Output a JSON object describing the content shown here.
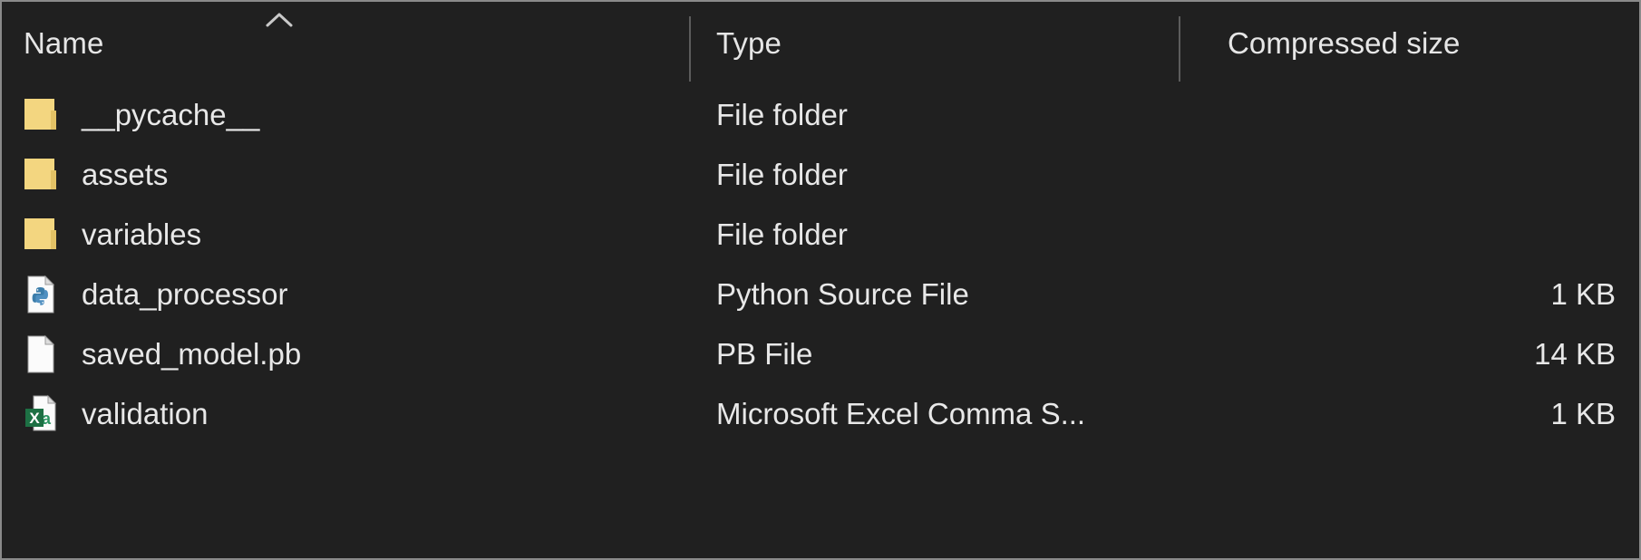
{
  "window": {
    "background_color": "#202020",
    "border_color": "#8a8a8a",
    "text_color": "#e8e8e8"
  },
  "columns": {
    "name": {
      "label": "Name",
      "sort_icon": "chevron-up-icon",
      "sort_direction": "ascending"
    },
    "type": {
      "label": "Type"
    },
    "size": {
      "label": "Compressed size"
    }
  },
  "files": [
    {
      "name": "__pycache__",
      "type": "File folder",
      "size": "",
      "icon": "folder-icon",
      "icon_color": "#f3d680"
    },
    {
      "name": "assets",
      "type": "File folder",
      "size": "",
      "icon": "folder-icon",
      "icon_color": "#f3d680"
    },
    {
      "name": "variables",
      "type": "File folder",
      "size": "",
      "icon": "folder-icon",
      "icon_color": "#f3d680"
    },
    {
      "name": "data_processor",
      "type": "Python Source File",
      "size": "1 KB",
      "icon": "python-file-icon",
      "icon_color": "#3b7daa"
    },
    {
      "name": "saved_model.pb",
      "type": "PB File",
      "size": "14 KB",
      "icon": "generic-file-icon",
      "icon_color": "#f4f4f4"
    },
    {
      "name": "validation",
      "type": "Microsoft Excel Comma S...",
      "size": "1 KB",
      "icon": "excel-csv-file-icon",
      "icon_color": "#1d7044"
    }
  ]
}
